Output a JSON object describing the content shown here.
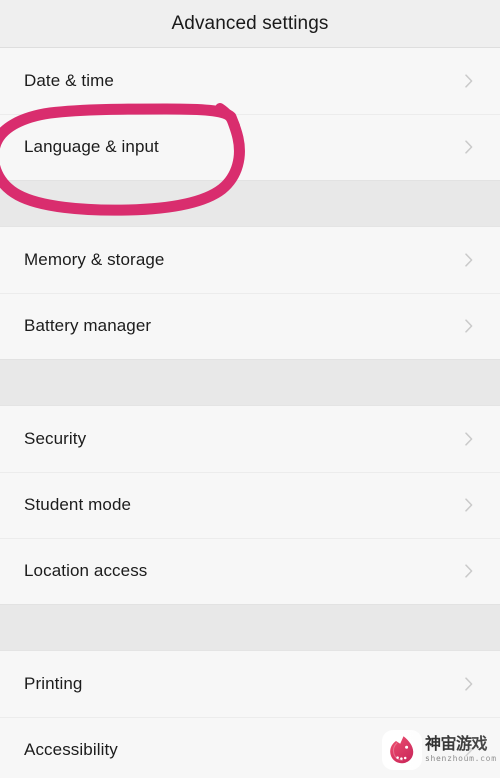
{
  "header": {
    "title": "Advanced settings"
  },
  "groups": [
    {
      "rows": [
        {
          "label": "Date & time",
          "icon": "chevron-right-icon"
        },
        {
          "label": "Language & input",
          "icon": "chevron-right-icon"
        }
      ]
    },
    {
      "rows": [
        {
          "label": "Memory & storage",
          "icon": "chevron-right-icon"
        },
        {
          "label": "Battery manager",
          "icon": "chevron-right-icon"
        }
      ]
    },
    {
      "rows": [
        {
          "label": "Security",
          "icon": "chevron-right-icon"
        },
        {
          "label": "Student mode",
          "icon": "chevron-right-icon"
        },
        {
          "label": "Location access",
          "icon": "chevron-right-icon"
        }
      ]
    },
    {
      "rows": [
        {
          "label": "Printing",
          "icon": "chevron-right-icon"
        },
        {
          "label": "Accessibility",
          "icon": "chevron-right-icon"
        }
      ]
    }
  ],
  "annotation": {
    "shape": "hand-drawn-ellipse",
    "target_label": "Language & input",
    "color": "#d92d6e"
  },
  "watermark": {
    "brand_cn": "神宙游戏",
    "url": "shenzhoum.com",
    "logo": "unicorn-head-logo",
    "logo_color": "#e0295c"
  },
  "colors": {
    "header_bg": "#efefef",
    "row_bg": "#f7f7f7",
    "gap_bg": "#e8e8e8",
    "divider": "#ececec",
    "text": "#1c1c1c",
    "chevron": "#c3c3c3",
    "annotation_pink": "#d92d6e"
  }
}
